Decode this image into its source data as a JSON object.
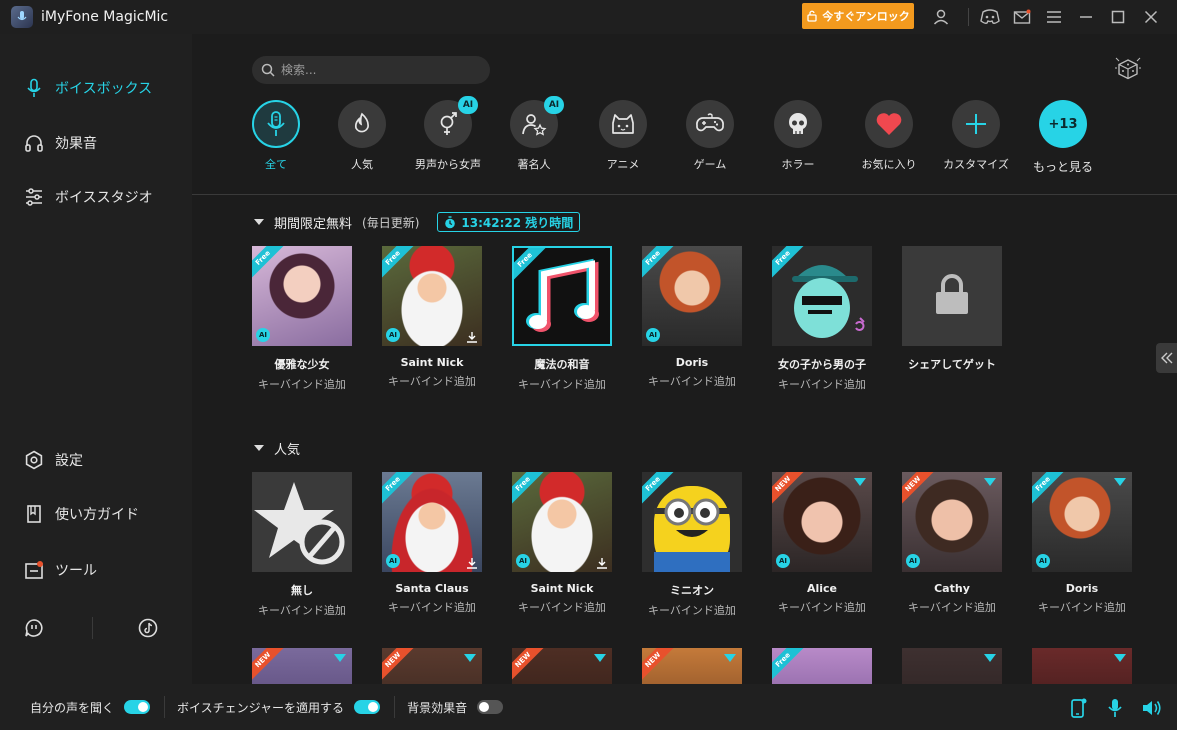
{
  "app": {
    "title": "iMyFone MagicMic",
    "unlock_label": "今すぐアンロック"
  },
  "colors": {
    "accent": "#27d3e6",
    "unlock": "#f39a1e",
    "new_ribbon": "#e8512c"
  },
  "sidebar": {
    "items": [
      {
        "label": "ボイスボックス",
        "icon": "microphone-icon",
        "active": true
      },
      {
        "label": "効果音",
        "icon": "headphones-icon"
      },
      {
        "label": "ボイススタジオ",
        "icon": "sliders-icon"
      },
      {
        "label": "設定",
        "icon": "gear-icon"
      },
      {
        "label": "使い方ガイド",
        "icon": "guide-icon"
      },
      {
        "label": "ツール",
        "icon": "tool-icon"
      }
    ]
  },
  "search": {
    "placeholder": "検索..."
  },
  "categories": [
    {
      "label": "全て",
      "icon": "microphone-icon",
      "active": true
    },
    {
      "label": "人気",
      "icon": "flame-icon"
    },
    {
      "label": "男声から女声",
      "icon": "gender-icon",
      "ai": "AI"
    },
    {
      "label": "著名人",
      "icon": "celebrity-icon",
      "ai": "AI"
    },
    {
      "label": "アニメ",
      "icon": "anime-icon"
    },
    {
      "label": "ゲーム",
      "icon": "gamepad-icon"
    },
    {
      "label": "ホラー",
      "icon": "skull-icon"
    },
    {
      "label": "お気に入り",
      "icon": "heart-icon"
    },
    {
      "label": "カスタマイズ",
      "icon": "plus-icon"
    },
    {
      "label": "もっと見る",
      "badge": "+13"
    }
  ],
  "limited": {
    "title": "期間限定無料",
    "note": "(毎日更新)",
    "timer": "13:42:22 残り時間",
    "cards": [
      {
        "name": "優雅な少女",
        "bind": "キーバインド追加",
        "ribbon": "Free",
        "ai": "AI"
      },
      {
        "name": "Saint Nick",
        "bind": "キーバインド追加",
        "ribbon": "Free",
        "ai": "AI"
      },
      {
        "name": "魔法の和音",
        "bind": "キーバインド追加",
        "ribbon": "Free"
      },
      {
        "name": "Doris",
        "bind": "キーバインド追加",
        "ribbon": "Free",
        "ai": "AI"
      },
      {
        "name": "女の子から男の子",
        "bind": "キーバインド追加",
        "ribbon": "Free"
      },
      {
        "name": "シェアしてゲット"
      }
    ]
  },
  "popular": {
    "title": "人気",
    "cards": [
      {
        "name": "無し",
        "bind": "キーバインド追加"
      },
      {
        "name": "Santa Claus",
        "bind": "キーバインド追加",
        "ribbon": "Free",
        "ai": "AI"
      },
      {
        "name": "Saint Nick",
        "bind": "キーバインド追加",
        "ribbon": "Free",
        "ai": "AI"
      },
      {
        "name": "ミニオン",
        "bind": "キーバインド追加",
        "ribbon": "Free"
      },
      {
        "name": "Alice",
        "bind": "キーバインド追加",
        "ribbon": "NEW",
        "ai": "AI"
      },
      {
        "name": "Cathy",
        "bind": "キーバインド追加",
        "ribbon": "NEW",
        "ai": "AI"
      },
      {
        "name": "Doris",
        "bind": "キーバインド追加",
        "ribbon": "Free",
        "ai": "AI"
      }
    ]
  },
  "third_row": {
    "ribbons": [
      "NEW",
      "NEW",
      "NEW",
      "NEW",
      "Free"
    ]
  },
  "bottom": {
    "hear_voice": "自分の声を聞く",
    "apply_changer": "ボイスチェンジャーを適用する",
    "bg_sound": "背景効果音"
  }
}
